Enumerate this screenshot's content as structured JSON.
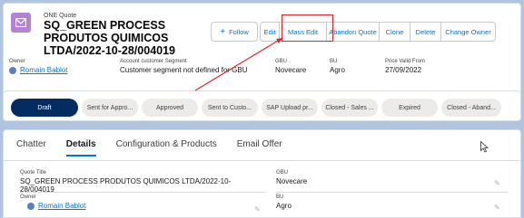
{
  "header": {
    "object_label": "ONE Quote",
    "title": "SQ_GREEN PROCESS PRODUTOS QUIMICOS LTDA/2022-10-28/004019",
    "follow_label": "Follow",
    "buttons": [
      "Edit",
      "Mass Edit",
      "Abandon Quote",
      "Clone",
      "Delete",
      "Change Owner"
    ],
    "fields": [
      {
        "label": "Owner",
        "value": "Romain Bablot"
      },
      {
        "label": "Account customer Segment",
        "value": "Customer segment not defined for GBU"
      },
      {
        "label": "GBU",
        "value": "Novecare"
      },
      {
        "label": "BU",
        "value": "Agro"
      },
      {
        "label": "Price Valid From",
        "value": "27/09/2022"
      }
    ]
  },
  "path": {
    "steps": [
      "Draft",
      "Sent for Appro...",
      "Approved",
      "Sent to Custo...",
      "SAP Upload pr...",
      "Closed - Sales ...",
      "Expired",
      "Closed - Aband..."
    ],
    "current": "Draft"
  },
  "tabs": [
    "Chatter",
    "Details",
    "Configuration & Products",
    "Email Offer"
  ],
  "active_tab": "Details",
  "details": {
    "quote_title_label": "Quote Title",
    "quote_title_value": "SQ_GREEN PROCESS PRODUTOS QUIMICOS LTDA/2022-10-28/004019",
    "gbu_label": "GBU",
    "gbu_value": "Novecare",
    "owner_label": "Owner",
    "owner_value": "Romain Bablot",
    "bu_label": "BU",
    "bu_value": "Agro"
  },
  "colors": {
    "brand": "#0176d3",
    "highlight": "#e0232b",
    "path_current": "#032d60",
    "object_icon": "#b781d3"
  }
}
